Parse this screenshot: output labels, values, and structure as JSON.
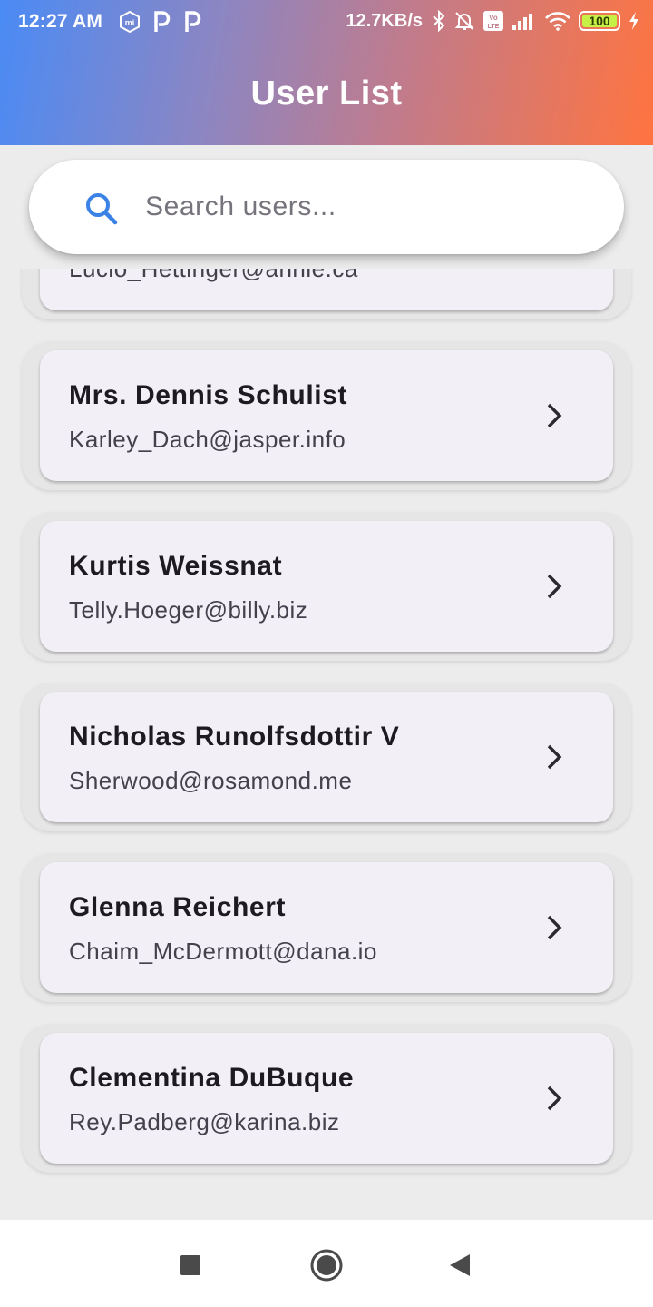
{
  "status_bar": {
    "time": "12:27 AM",
    "network_speed": "12.7KB/s",
    "battery_level": "100",
    "icons": [
      "mi-icon",
      "parking-icon",
      "parking-icon",
      "bluetooth-icon",
      "bell-off-icon",
      "volte-icon",
      "signal-icon",
      "wifi-icon",
      "battery-icon",
      "charging-icon"
    ]
  },
  "header": {
    "title": "User List"
  },
  "search": {
    "placeholder": "Search users...",
    "value": ""
  },
  "users": [
    {
      "name": "",
      "email": "Lucio_Hettinger@annie.ca"
    },
    {
      "name": "Mrs. Dennis Schulist",
      "email": "Karley_Dach@jasper.info"
    },
    {
      "name": "Kurtis Weissnat",
      "email": "Telly.Hoeger@billy.biz"
    },
    {
      "name": "Nicholas Runolfsdottir V",
      "email": "Sherwood@rosamond.me"
    },
    {
      "name": "Glenna Reichert",
      "email": "Chaim_McDermott@dana.io"
    },
    {
      "name": "Clementina DuBuque",
      "email": "Rey.Padberg@karina.biz"
    }
  ],
  "colors": {
    "header_gradient_start": "#4a8bf5",
    "header_gradient_end": "#ff7440",
    "search_icon": "#3b82e6",
    "card_background": "#f3eff7"
  }
}
